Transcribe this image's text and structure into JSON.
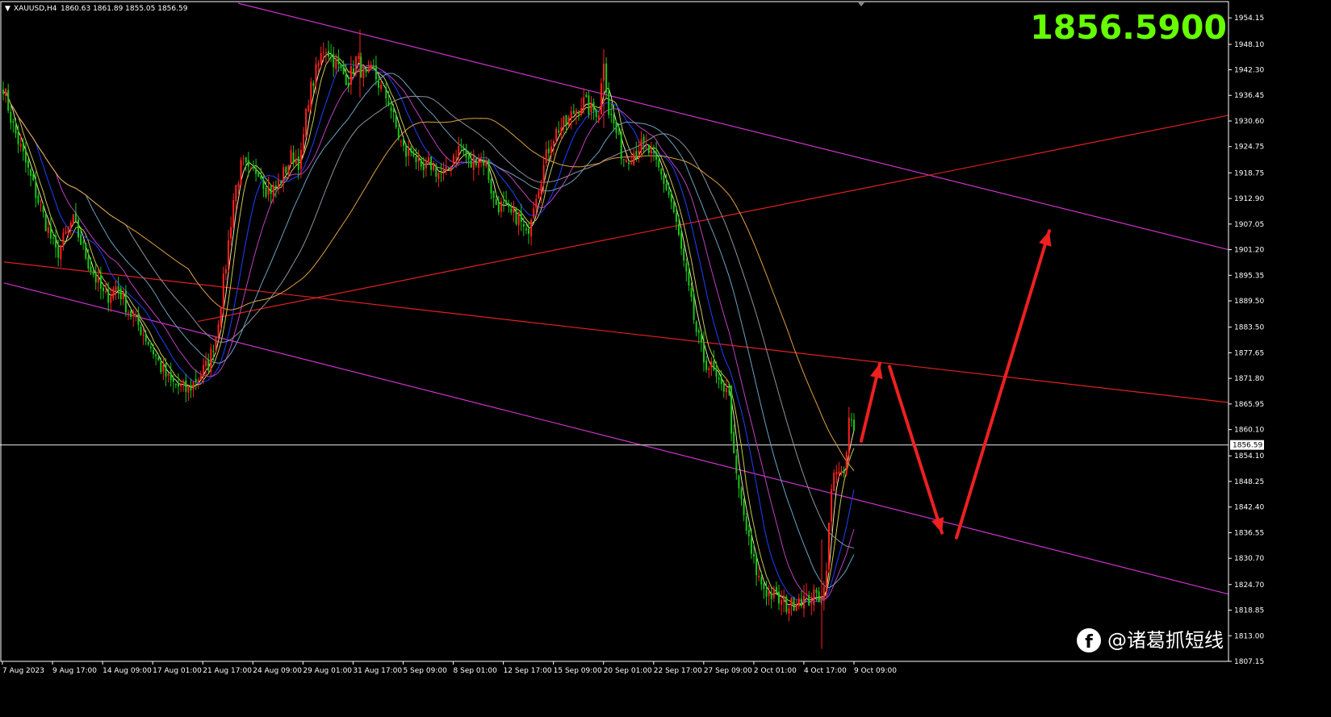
{
  "header": {
    "symbol": "XAUUSD,H4",
    "ohlc": "1860.63 1861.89 1855.05 1856.59",
    "big_price": "1856.5900"
  },
  "watermark": {
    "text": "@诸葛抓短线"
  },
  "colors": {
    "background": "#000000",
    "bull": "#ff2020",
    "bear": "#17c817",
    "channel": "#cc33cc",
    "trendline": "#e02020",
    "arrow": "#ee2020",
    "big_price": "#66ff00",
    "axis_text": "#ffffff",
    "ma_colors": [
      "#e8e8a0",
      "#c8c850",
      "#2040ff",
      "#c040c0",
      "#6aa0c0",
      "#9090a0",
      "#e0a040"
    ]
  },
  "chart_data": {
    "type": "candlestick",
    "symbol": "XAUUSD",
    "timeframe": "H4",
    "current_price": "1856.59",
    "ylim": [
      1807.15,
      1957.5
    ],
    "y_ticks": [
      "1954.15",
      "1948.10",
      "1942.30",
      "1936.45",
      "1930.60",
      "1924.75",
      "1918.75",
      "1912.90",
      "1907.05",
      "1901.20",
      "1895.35",
      "1889.50",
      "1883.50",
      "1877.65",
      "1871.80",
      "1865.95",
      "1860.10",
      "1854.10",
      "1848.25",
      "1842.40",
      "1836.55",
      "1830.70",
      "1824.70",
      "1818.85",
      "1813.00",
      "1807.15"
    ],
    "x_ticks": [
      "7 Aug 2023",
      "9 Aug 17:00",
      "14 Aug 09:00",
      "17 Aug 01:00",
      "21 Aug 17:00",
      "24 Aug 09:00",
      "29 Aug 01:00",
      "31 Aug 17:00",
      "5 Sep 09:00",
      "8 Sep 01:00",
      "12 Sep 17:00",
      "15 Sep 09:00",
      "20 Sep 01:00",
      "22 Sep 17:00",
      "27 Sep 09:00",
      "2 Oct 01:00",
      "4 Oct 17:00",
      "9 Oct 09:00"
    ],
    "price_path": [
      [
        0,
        1942
      ],
      [
        15,
        1930
      ],
      [
        30,
        1922
      ],
      [
        48,
        1912
      ],
      [
        70,
        1900
      ],
      [
        90,
        1908
      ],
      [
        110,
        1898
      ],
      [
        130,
        1890
      ],
      [
        145,
        1893
      ],
      [
        160,
        1887
      ],
      [
        175,
        1883
      ],
      [
        190,
        1878
      ],
      [
        200,
        1874
      ],
      [
        210,
        1871
      ],
      [
        220,
        1870
      ],
      [
        232,
        1869
      ],
      [
        245,
        1872
      ],
      [
        258,
        1875
      ],
      [
        268,
        1882
      ],
      [
        280,
        1898
      ],
      [
        290,
        1914
      ],
      [
        300,
        1921
      ],
      [
        310,
        1918
      ],
      [
        320,
        1920
      ],
      [
        330,
        1915
      ],
      [
        340,
        1915
      ],
      [
        350,
        1918
      ],
      [
        362,
        1923
      ],
      [
        372,
        1921
      ],
      [
        382,
        1936
      ],
      [
        392,
        1942
      ],
      [
        402,
        1948
      ],
      [
        412,
        1945
      ],
      [
        422,
        1942
      ],
      [
        432,
        1940
      ],
      [
        442,
        1945
      ],
      [
        452,
        1940
      ],
      [
        462,
        1942
      ],
      [
        472,
        1938
      ],
      [
        482,
        1935
      ],
      [
        492,
        1928
      ],
      [
        502,
        1923
      ],
      [
        512,
        1924
      ],
      [
        522,
        1918
      ],
      [
        532,
        1921
      ],
      [
        542,
        1919
      ],
      [
        552,
        1918
      ],
      [
        562,
        1923
      ],
      [
        572,
        1925
      ],
      [
        582,
        1920
      ],
      [
        592,
        1923
      ],
      [
        602,
        1921
      ],
      [
        612,
        1912
      ],
      [
        622,
        1911
      ],
      [
        632,
        1909
      ],
      [
        642,
        1909
      ],
      [
        652,
        1904
      ],
      [
        662,
        1913
      ],
      [
        672,
        1919
      ],
      [
        682,
        1926
      ],
      [
        692,
        1929
      ],
      [
        702,
        1930
      ],
      [
        712,
        1933
      ],
      [
        722,
        1935
      ],
      [
        732,
        1933
      ],
      [
        742,
        1933
      ],
      [
        748,
        1945
      ],
      [
        754,
        1933
      ],
      [
        762,
        1929
      ],
      [
        772,
        1922
      ],
      [
        782,
        1923
      ],
      [
        792,
        1925
      ],
      [
        802,
        1924
      ],
      [
        812,
        1921
      ],
      [
        822,
        1917
      ],
      [
        832,
        1912
      ],
      [
        842,
        1903
      ],
      [
        852,
        1893
      ],
      [
        862,
        1883
      ],
      [
        872,
        1876
      ],
      [
        882,
        1874
      ],
      [
        892,
        1869
      ],
      [
        902,
        1871
      ],
      [
        910,
        1851
      ],
      [
        920,
        1842
      ],
      [
        930,
        1832
      ],
      [
        940,
        1826
      ],
      [
        950,
        1823
      ],
      [
        960,
        1822
      ],
      [
        970,
        1820
      ],
      [
        980,
        1820
      ],
      [
        990,
        1822
      ],
      [
        1000,
        1821
      ],
      [
        1010,
        1822
      ],
      [
        1020,
        1822
      ],
      [
        1025,
        1832
      ],
      [
        1030,
        1846
      ],
      [
        1036,
        1852
      ],
      [
        1040,
        1851
      ],
      [
        1046,
        1848
      ],
      [
        1052,
        1863
      ],
      [
        1058,
        1859
      ],
      [
        1062,
        1857
      ]
    ],
    "moving_averages": [
      {
        "period": "fast",
        "color": "#e8e8a0"
      },
      {
        "period": "mid",
        "color": "#c8c850"
      },
      {
        "period": "slow",
        "color": "#2040ff"
      },
      {
        "period": "slower",
        "color": "#c040c0"
      },
      {
        "period": "long",
        "color": "#6aa0c0"
      },
      {
        "period": "longer",
        "color": "#9090a0"
      },
      {
        "period": "longest",
        "color": "#e0a040"
      }
    ],
    "lines": [
      {
        "name": "channel-upper",
        "color": "#cc33cc",
        "from": [
          295,
          1957.5
        ],
        "to": [
          1522,
          1901.2
        ]
      },
      {
        "name": "channel-lower",
        "color": "#cc33cc",
        "from": [
          5,
          1893.6
        ],
        "to": [
          1522,
          1822.5
        ]
      },
      {
        "name": "trendline-rising",
        "color": "#e02020",
        "from": [
          245,
          1884.8
        ],
        "to": [
          1522,
          1931.9
        ]
      },
      {
        "name": "trendline-falling",
        "color": "#e02020",
        "from": [
          5,
          1898.4
        ],
        "to": [
          1522,
          1866.3
        ]
      },
      {
        "name": "current-price-line",
        "color": "#bbbbbb",
        "from": [
          0,
          1856.6
        ],
        "to": [
          1522,
          1856.6
        ]
      }
    ],
    "forecast_arrows": [
      {
        "from": [
          1067,
          1857.5
        ],
        "to": [
          1090,
          1875.2
        ]
      },
      {
        "from": [
          1102,
          1874.5
        ],
        "to": [
          1167,
          1836.5
        ]
      },
      {
        "from": [
          1185,
          1835.4
        ],
        "to": [
          1300,
          1905.5
        ]
      }
    ]
  }
}
